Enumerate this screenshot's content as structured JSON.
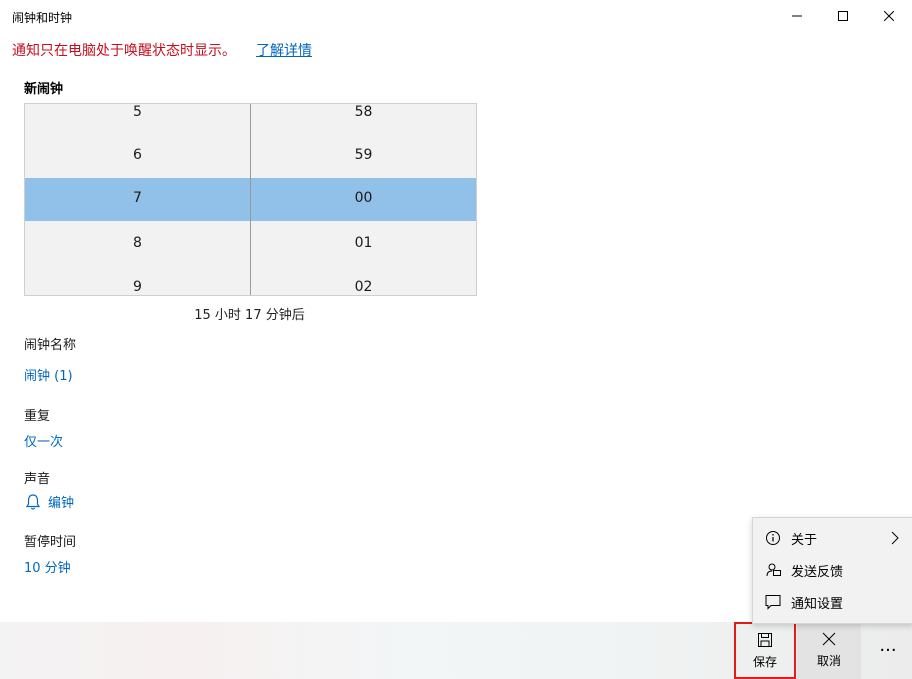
{
  "window": {
    "title": "闹钟和时钟"
  },
  "notice": {
    "text": "通知只在电脑处于唤醒状态时显示。",
    "link": "了解详情",
    "color": "#c50f1f"
  },
  "section_title": "新闹钟",
  "time_picker": {
    "hours": [
      "5",
      "6",
      "7",
      "8",
      "9"
    ],
    "minutes": [
      "58",
      "59",
      "00",
      "01",
      "02"
    ],
    "selected_hour": "7",
    "selected_minute": "00",
    "selection_color": "#91c0e8"
  },
  "countdown": "15 小时 17 分钟后",
  "fields": {
    "name": {
      "label": "闹钟名称",
      "value": "闹钟 (1)"
    },
    "repeat": {
      "label": "重复",
      "value": "仅一次"
    },
    "sound": {
      "label": "声音",
      "value": "编钟",
      "icon": "bell-icon"
    },
    "snooze": {
      "label": "暂停时间",
      "value": "10 分钟"
    }
  },
  "menu": {
    "items": [
      {
        "label": "关于",
        "icon": "info-icon"
      },
      {
        "label": "发送反馈",
        "icon": "feedback-icon"
      },
      {
        "label": "通知设置",
        "icon": "chat-icon"
      }
    ]
  },
  "commands": {
    "save": "保存",
    "cancel": "取消",
    "more": "···"
  },
  "accent_color": "#0067c0"
}
